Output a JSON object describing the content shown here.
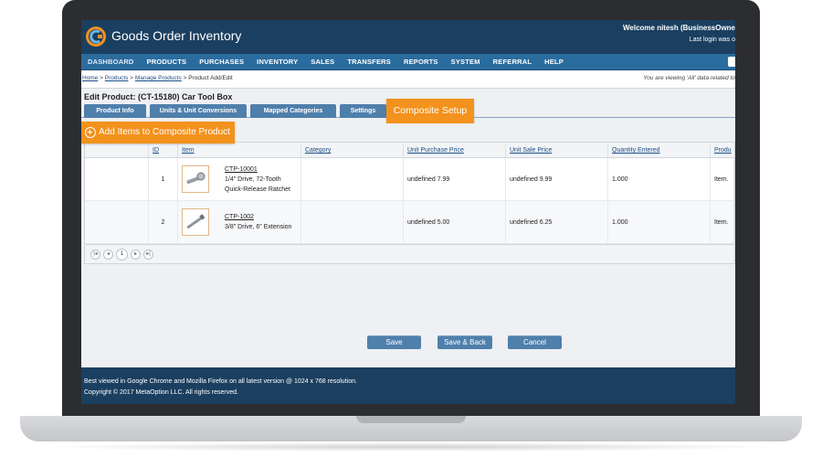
{
  "app": {
    "title": "Goods Order Inventory",
    "welcome": "Welcome nitesh (BusinessOwne",
    "last_login": "Last login was o"
  },
  "nav": [
    {
      "label": "DASHBOARD"
    },
    {
      "label": "PRODUCTS"
    },
    {
      "label": "PURCHASES"
    },
    {
      "label": "INVENTORY"
    },
    {
      "label": "SALES"
    },
    {
      "label": "TRANSFERS"
    },
    {
      "label": "REPORTS"
    },
    {
      "label": "SYSTEM"
    },
    {
      "label": "REFERRAL"
    },
    {
      "label": "HELP"
    }
  ],
  "breadcrumb": {
    "home": "Home",
    "sep1": " > ",
    "products": "Products",
    "sep2": " > ",
    "manage": "Manage Products",
    "sep3": " > ",
    "current": "Product Add/Edit"
  },
  "viewing_note": "You are viewing 'All' data related to",
  "page_title": "Edit Product: (CT-15180) Car Tool Box",
  "tabs": [
    {
      "label": "Product Info"
    },
    {
      "label": "Units & Unit Conversions"
    },
    {
      "label": "Mapped Categories"
    },
    {
      "label": "Settings"
    },
    {
      "label": "Composite Setup"
    }
  ],
  "add_items_label": "Add Items to Composite Product",
  "grid": {
    "columns": [
      "ID",
      "Item",
      "Category",
      "Unit Purchase Price",
      "Unit Sale Price",
      "Quantity Entered",
      "Produ"
    ],
    "rows": [
      {
        "id": "1",
        "code": "CTP-10001",
        "desc": "1/4\" Drive, 72-Tooth Quick-Release Ratchet",
        "category": "",
        "purchase_price": "undefined 7.99",
        "sale_price": "undefined 9.99",
        "quantity": "1.000",
        "produ": "Item."
      },
      {
        "id": "2",
        "code": "CTP-1002",
        "desc": "3/8\" Drive, 6\" Extension",
        "category": "",
        "purchase_price": "undefined 5.00",
        "sale_price": "undefined 6.25",
        "quantity": "1.000",
        "produ": "Item."
      }
    ]
  },
  "pager": {
    "current_page": "1"
  },
  "buttons": {
    "save": "Save",
    "save_back": "Save & Back",
    "cancel": "Cancel"
  },
  "footer": {
    "line1": "Best viewed in Google Chrome and Mozilla Firefox on all latest version @ 1024 x 768 resolution.",
    "line2": "Copyright © 2017 MetaOption LLC. All rights reserved."
  },
  "colors": {
    "header": "#1b3f60",
    "nav": "#2b6c9f",
    "tab": "#4f7fab",
    "accent_orange": "#f3921d"
  }
}
